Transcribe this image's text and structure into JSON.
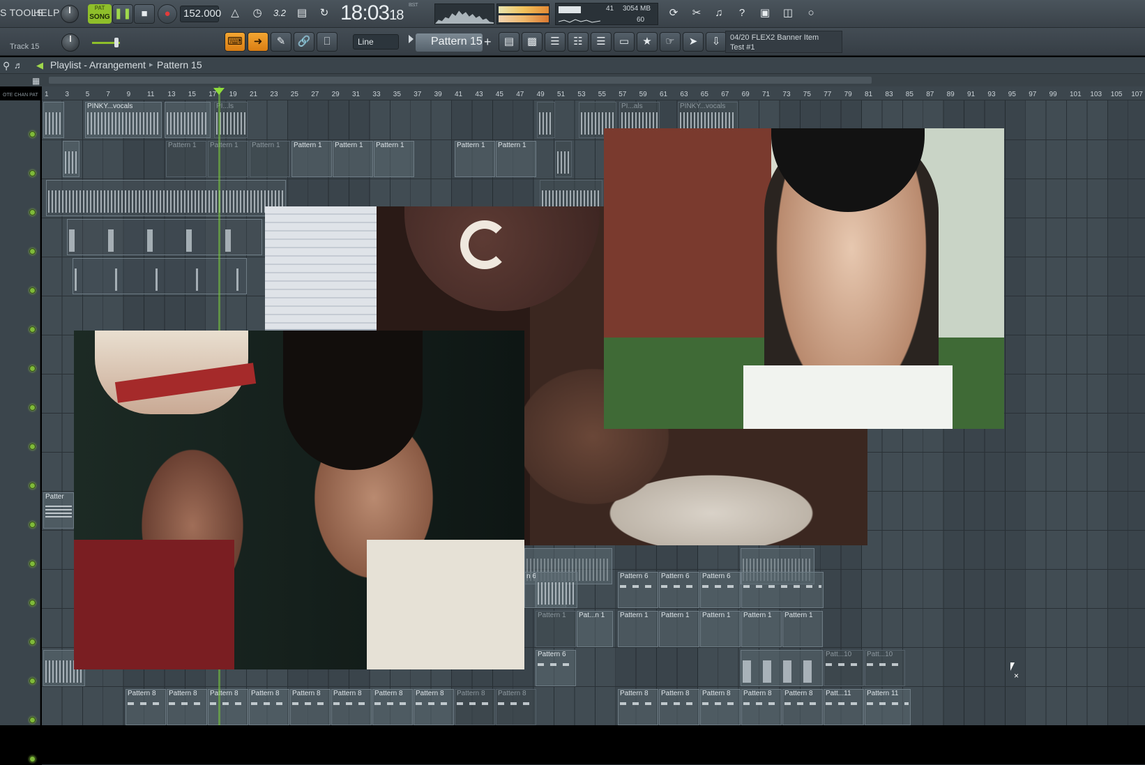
{
  "menu": {
    "tools": "S TOOLS",
    "help": "HELP"
  },
  "transport": {
    "song_label": "SONG",
    "pat_label": "PAT",
    "tempo": "152.000",
    "time_main": "18:03",
    "time_sub": "18",
    "time_unit": "B:S:T"
  },
  "monitor": {
    "cpu": "41",
    "ram": "3054 MB",
    "poly": "60"
  },
  "toolbar2": {
    "track": "Track 15",
    "snap": "Line",
    "pattern": "Pattern 15",
    "hint_line1": "04/20  FLEX2 Banner Item",
    "hint_line2": "Test #1"
  },
  "playlist": {
    "title": "Playlist - Arrangement",
    "crumb": "Pattern 15"
  },
  "ruler": [
    "1",
    "3",
    "5",
    "7",
    "9",
    "11",
    "13",
    "15",
    "17",
    "19",
    "21",
    "23",
    "25",
    "27",
    "29",
    "31",
    "33",
    "35",
    "37",
    "39",
    "41",
    "43",
    "45",
    "47",
    "49",
    "51",
    "53",
    "55",
    "57",
    "59",
    "61",
    "63",
    "65",
    "67",
    "69",
    "71",
    "73",
    "75",
    "77",
    "79",
    "81",
    "83",
    "85",
    "87",
    "89",
    "91",
    "93",
    "95",
    "97",
    "99",
    "101",
    "103",
    "105",
    "107"
  ],
  "clips": {
    "r1a": "PINKY...vocals",
    "r1b": "PI...ls",
    "r1c": "PI...als",
    "r1d": "PINKY...vocals",
    "p1": "Pattern 1",
    "pat_trunc": "Patter",
    "p6": "Pattern 6",
    "p6s": "n 6",
    "pn1": "Pat...n 1",
    "p8": "Pattern 8",
    "p10": "Patt...10",
    "p11": "Patt...11",
    "p11full": "Pattern 11"
  },
  "colors": {
    "accent_green": "#8fbf2a",
    "accent_orange": "#f4a632",
    "bg": "#3b454c"
  }
}
